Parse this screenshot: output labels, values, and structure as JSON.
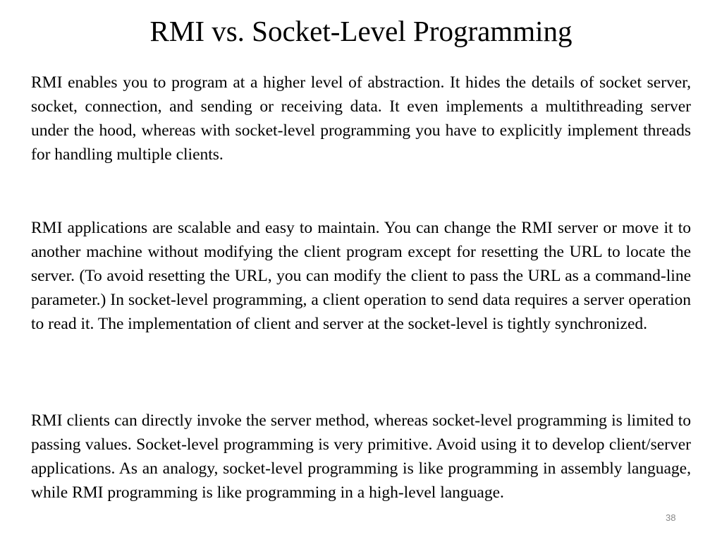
{
  "slide": {
    "title": "RMI vs. Socket-Level Programming",
    "paragraphs": [
      "RMI enables you to program at a higher level of abstraction. It hides the details of socket server, socket, connection, and sending or receiving data. It even implements a multithreading server under the hood, whereas with socket-level programming you have to explicitly implement threads for handling multiple clients.",
      "RMI applications are scalable and easy to maintain. You can change the RMI server or move it to another machine without modifying the client program except for resetting the URL to locate the server. (To avoid resetting the URL, you can modify the client to pass the URL as a command-line parameter.) In socket-level programming, a client operation to send data requires a server operation to read it. The implementation of client and server at the socket-level is tightly synchronized.",
      "RMI clients can directly invoke the server method, whereas socket-level programming is limited to passing values. Socket-level programming is very primitive. Avoid using it to develop client/server applications. As an analogy, socket-level programming is like programming in assembly language, while RMI programming is like programming in a high-level language."
    ],
    "page_number": "38"
  }
}
